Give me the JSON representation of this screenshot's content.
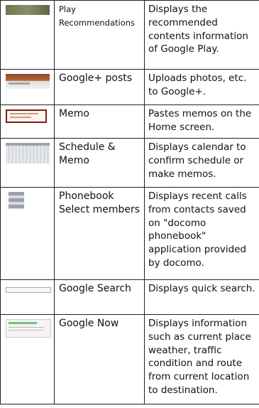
{
  "rows": [
    {
      "thumb_icon": "play-recommendations-thumbnail",
      "name": "Play Recommendations",
      "desc": "Displays the recommended contents information of Google Play."
    },
    {
      "thumb_icon": "google-plus-posts-thumbnail",
      "name": "Google+ posts",
      "desc": "Uploads photos, etc. to Google+."
    },
    {
      "thumb_icon": "memo-thumbnail",
      "name": "Memo",
      "desc": "Pastes memos on the Home screen."
    },
    {
      "thumb_icon": "schedule-memo-thumbnail",
      "name": "Schedule & Memo",
      "desc": "Displays calendar to confirm schedule or make memos."
    },
    {
      "thumb_icon": "phonebook-thumbnail",
      "name": "Phonebook Select members",
      "desc": "Displays recent calls from contacts saved on \"docomo phonebook\" application provided by docomo."
    },
    {
      "thumb_icon": "google-search-thumbnail",
      "name": "Google Search",
      "desc": "Displays quick search."
    },
    {
      "thumb_icon": "google-now-thumbnail",
      "name": "Google Now",
      "desc": "Displays information such as current place weather, traffic condition and route from current location to destination."
    }
  ]
}
